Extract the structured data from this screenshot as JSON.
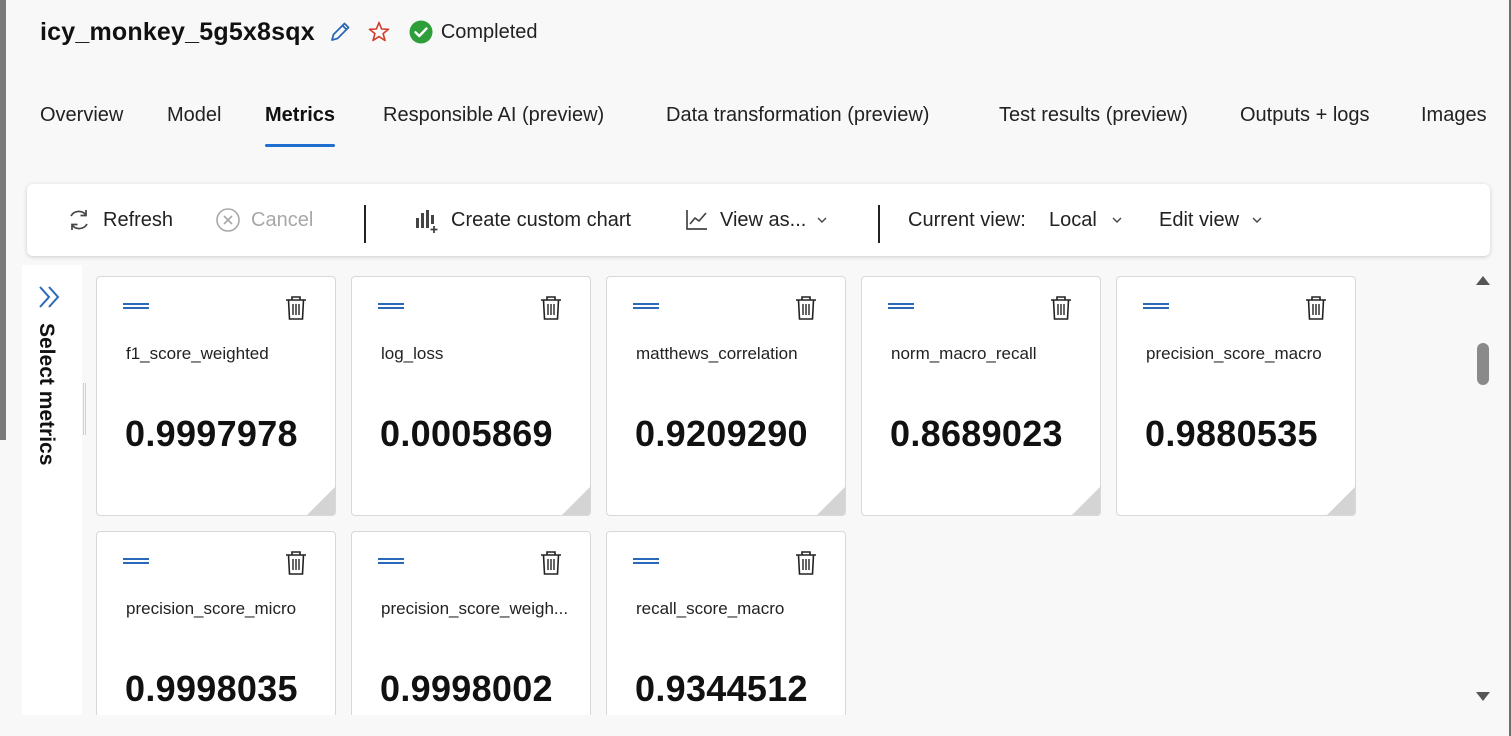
{
  "header": {
    "title": "icy_monkey_5g5x8sqx",
    "status": "Completed"
  },
  "tabs": [
    {
      "label": "Overview"
    },
    {
      "label": "Model"
    },
    {
      "label": "Metrics",
      "active": true
    },
    {
      "label": "Responsible AI (preview)"
    },
    {
      "label": "Data transformation (preview)"
    },
    {
      "label": "Test results (preview)"
    },
    {
      "label": "Outputs + logs"
    },
    {
      "label": "Images"
    }
  ],
  "toolbar": {
    "refresh_label": "Refresh",
    "cancel_label": "Cancel",
    "create_chart_label": "Create custom chart",
    "view_as_label": "View as...",
    "current_view_label": "Current view:",
    "current_view_value": "Local",
    "edit_view_label": "Edit view"
  },
  "panel": {
    "label": "Select metrics"
  },
  "metrics": [
    {
      "name": "f1_score_weighted",
      "value": "0.9997978"
    },
    {
      "name": "log_loss",
      "value": "0.0005869"
    },
    {
      "name": "matthews_correlation",
      "value": "0.9209290"
    },
    {
      "name": "norm_macro_recall",
      "value": "0.8689023"
    },
    {
      "name": "precision_score_macro",
      "value": "0.9880535"
    },
    {
      "name": "precision_score_micro",
      "value": "0.9998035"
    },
    {
      "name": "precision_score_weigh...",
      "value": "0.9998002"
    },
    {
      "name": "recall_score_macro",
      "value": "0.9344512"
    }
  ],
  "colors": {
    "accent": "#1f6fd1",
    "status_success": "#2e9e3a",
    "star": "#d13b2a",
    "text": "#1b1b1b"
  },
  "icons": {
    "edit": "pencil-icon",
    "favorite": "star-icon",
    "status": "check-circle-icon",
    "refresh": "refresh-icon",
    "cancel": "cancel-icon",
    "chart": "bar-chart-add-icon",
    "view_as": "line-chart-icon",
    "panel_toggle": "double-chevron-right-icon",
    "delete": "trash-icon",
    "drag": "drag-handle-icon"
  }
}
